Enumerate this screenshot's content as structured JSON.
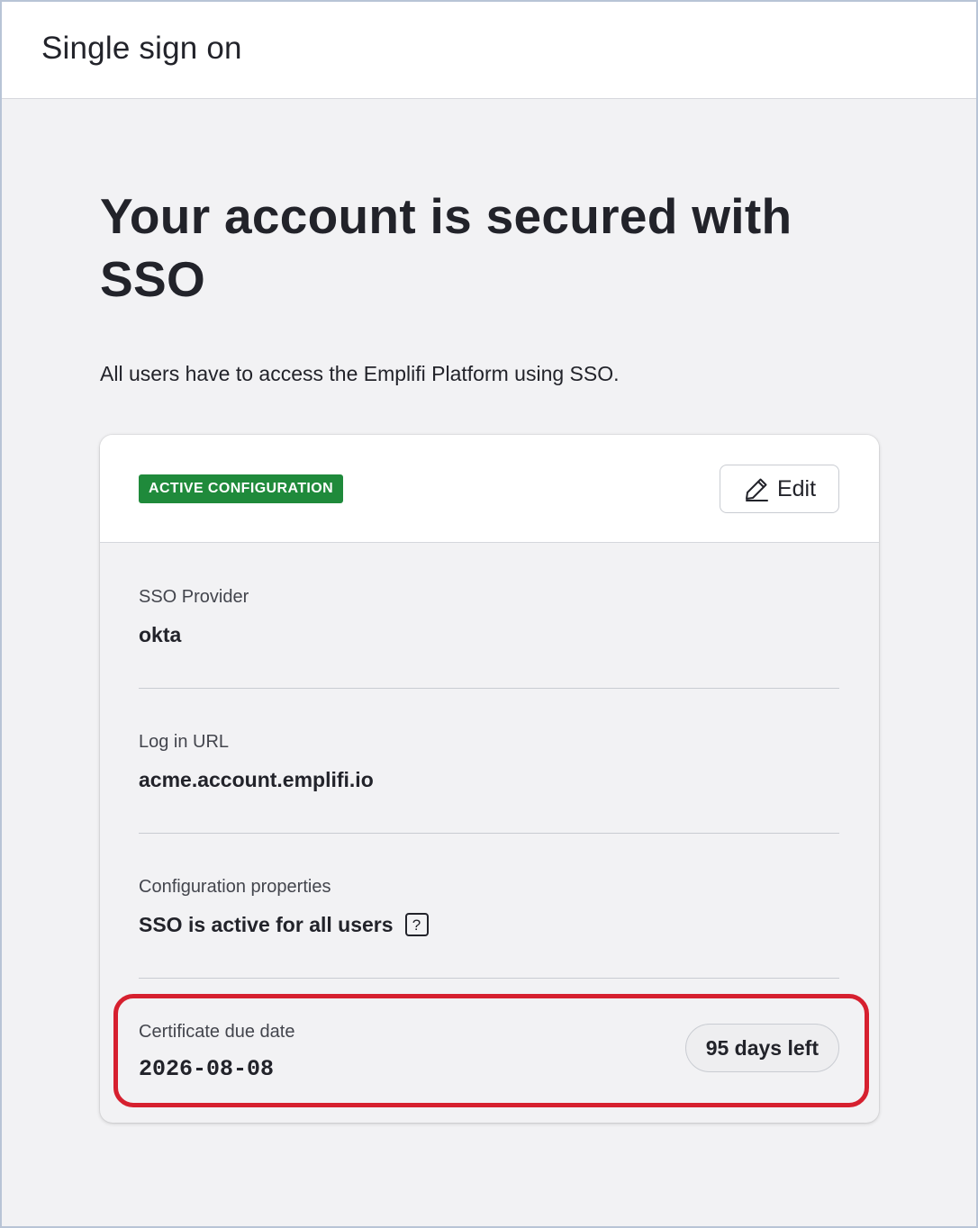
{
  "header": {
    "title": "Single sign on"
  },
  "hero": {
    "title": "Your account is secured with SSO",
    "subtitle": "All users have to access the Emplifi Platform using SSO."
  },
  "card": {
    "badge": "ACTIVE CONFIGURATION",
    "edit_label": "Edit",
    "rows": [
      {
        "label": "SSO Provider",
        "value": "okta"
      },
      {
        "label": "Log in URL",
        "value": "acme.account.emplifi.io"
      },
      {
        "label": "Configuration properties",
        "value": "SSO is active for all users",
        "help_icon": "question-mark-icon"
      },
      {
        "label": "Certificate due date",
        "value": "2026-08-08",
        "status": "95 days left"
      }
    ]
  },
  "colors": {
    "badge_bg": "#1f8a3b",
    "highlight_border": "#d6202f",
    "page_bg": "#f2f2f4"
  },
  "icons": {
    "edit": "pencil-icon",
    "help": "question-mark-icon"
  }
}
